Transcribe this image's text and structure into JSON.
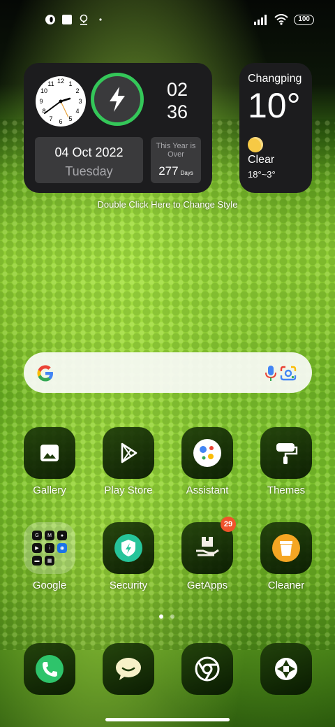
{
  "status_bar": {
    "left_icons": [
      "opera-icon",
      "square-notification-icon",
      "location-pin-icon",
      "dot-icon"
    ],
    "battery": "100"
  },
  "clock_widget": {
    "hours": "02",
    "minutes": "36",
    "date": "04 Oct 2022",
    "weekday": "Tuesday",
    "year_title": "This Year is Over",
    "days_over": "277",
    "days_unit": "Days"
  },
  "weather_widget": {
    "city": "Changping",
    "temperature": "10°",
    "condition": "Clear",
    "range": "18°~3°"
  },
  "style_hint": "Double Click Here to Change Style",
  "search": {
    "placeholder": ""
  },
  "apps_row1": [
    {
      "label": "Gallery",
      "icon": "gallery-icon"
    },
    {
      "label": "Play Store",
      "icon": "play-store-icon"
    },
    {
      "label": "Assistant",
      "icon": "assistant-icon"
    },
    {
      "label": "Themes",
      "icon": "themes-icon"
    }
  ],
  "apps_row2": [
    {
      "label": "Google",
      "icon": "google-folder-icon"
    },
    {
      "label": "Security",
      "icon": "security-icon"
    },
    {
      "label": "GetApps",
      "icon": "getapps-icon",
      "badge": "29"
    },
    {
      "label": "Cleaner",
      "icon": "cleaner-icon"
    }
  ],
  "dock": [
    {
      "icon": "phone-icon"
    },
    {
      "icon": "messages-icon"
    },
    {
      "icon": "chrome-icon"
    },
    {
      "icon": "camera-icon"
    }
  ],
  "page_indicator": {
    "pages": 2,
    "current": 1
  },
  "colors": {
    "widget_bg": "#1c1c1e",
    "charge_ring": "#34c759",
    "badge": "#f0532b"
  }
}
